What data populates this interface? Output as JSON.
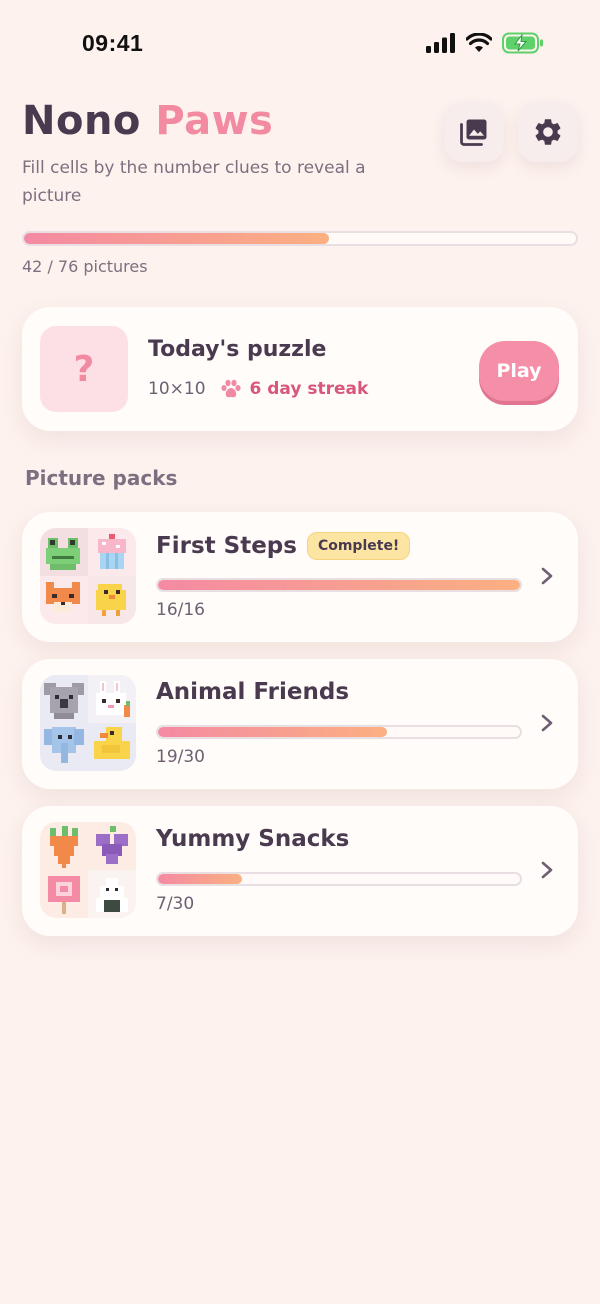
{
  "status_bar": {
    "time": "09:41"
  },
  "header": {
    "title_part1": "Nono",
    "title_part2": "Paws",
    "subtitle": "Fill cells by the number clues to reveal a picture",
    "gallery_icon": "gallery-icon",
    "settings_icon": "gear-icon"
  },
  "overall_progress": {
    "solved": 42,
    "total": 76,
    "fraction": 0.553,
    "label": "42 / 76 pictures"
  },
  "today": {
    "thumb_symbol": "?",
    "title": "Today's puzzle",
    "size": "10×10",
    "streak": "6 day streak",
    "play_label": "Play"
  },
  "section_title": "Picture packs",
  "packs": [
    {
      "name": "First Steps",
      "badge": "Complete!",
      "count": "16/16",
      "fraction": 1.0
    },
    {
      "name": "Animal Friends",
      "badge": "",
      "count": "19/30",
      "fraction": 0.633
    },
    {
      "name": "Yummy Snacks",
      "badge": "",
      "count": "7/30",
      "fraction": 0.233
    }
  ],
  "colors": {
    "accent": "#f28aa2",
    "background": "#fdf2ee",
    "text": "#4a3a4f",
    "badge": "#fce5a3"
  }
}
